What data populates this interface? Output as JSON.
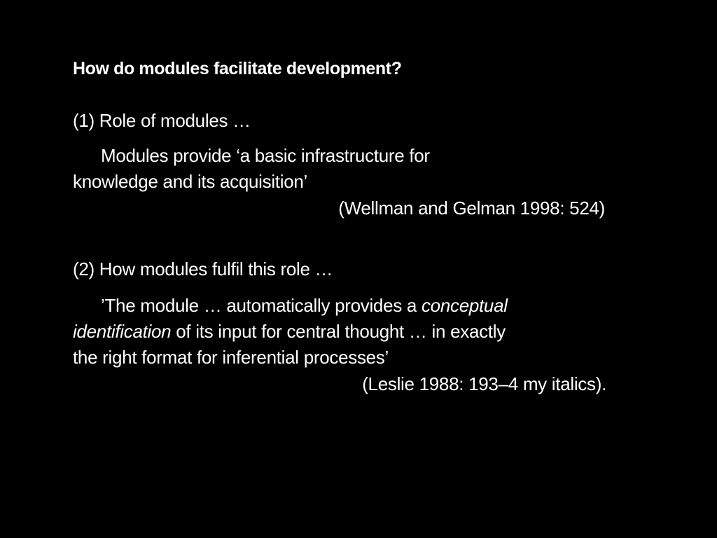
{
  "slide": {
    "title": "How do modules facilitate development?",
    "section1": {
      "heading": "(1) Role of modules …",
      "quote_line1": "Modules provide ‘a basic infrastructure for",
      "quote_line2": "knowledge and its acquisition’",
      "citation": "(Wellman and Gelman 1998: 524)"
    },
    "section2": {
      "heading": "(2) How modules fulfil this role …",
      "quote_line1_a": "’The module … automatically provides a ",
      "quote_line1_b": "conceptual",
      "quote_line2_a": "identification",
      "quote_line2_b": " of its input for central thought … in exactly",
      "quote_line3": "the right format for inferential processes’",
      "citation": "(Leslie 1988: 193–4 my italics)."
    }
  },
  "colors": {
    "background": "#000000",
    "text": "#ffffff"
  }
}
